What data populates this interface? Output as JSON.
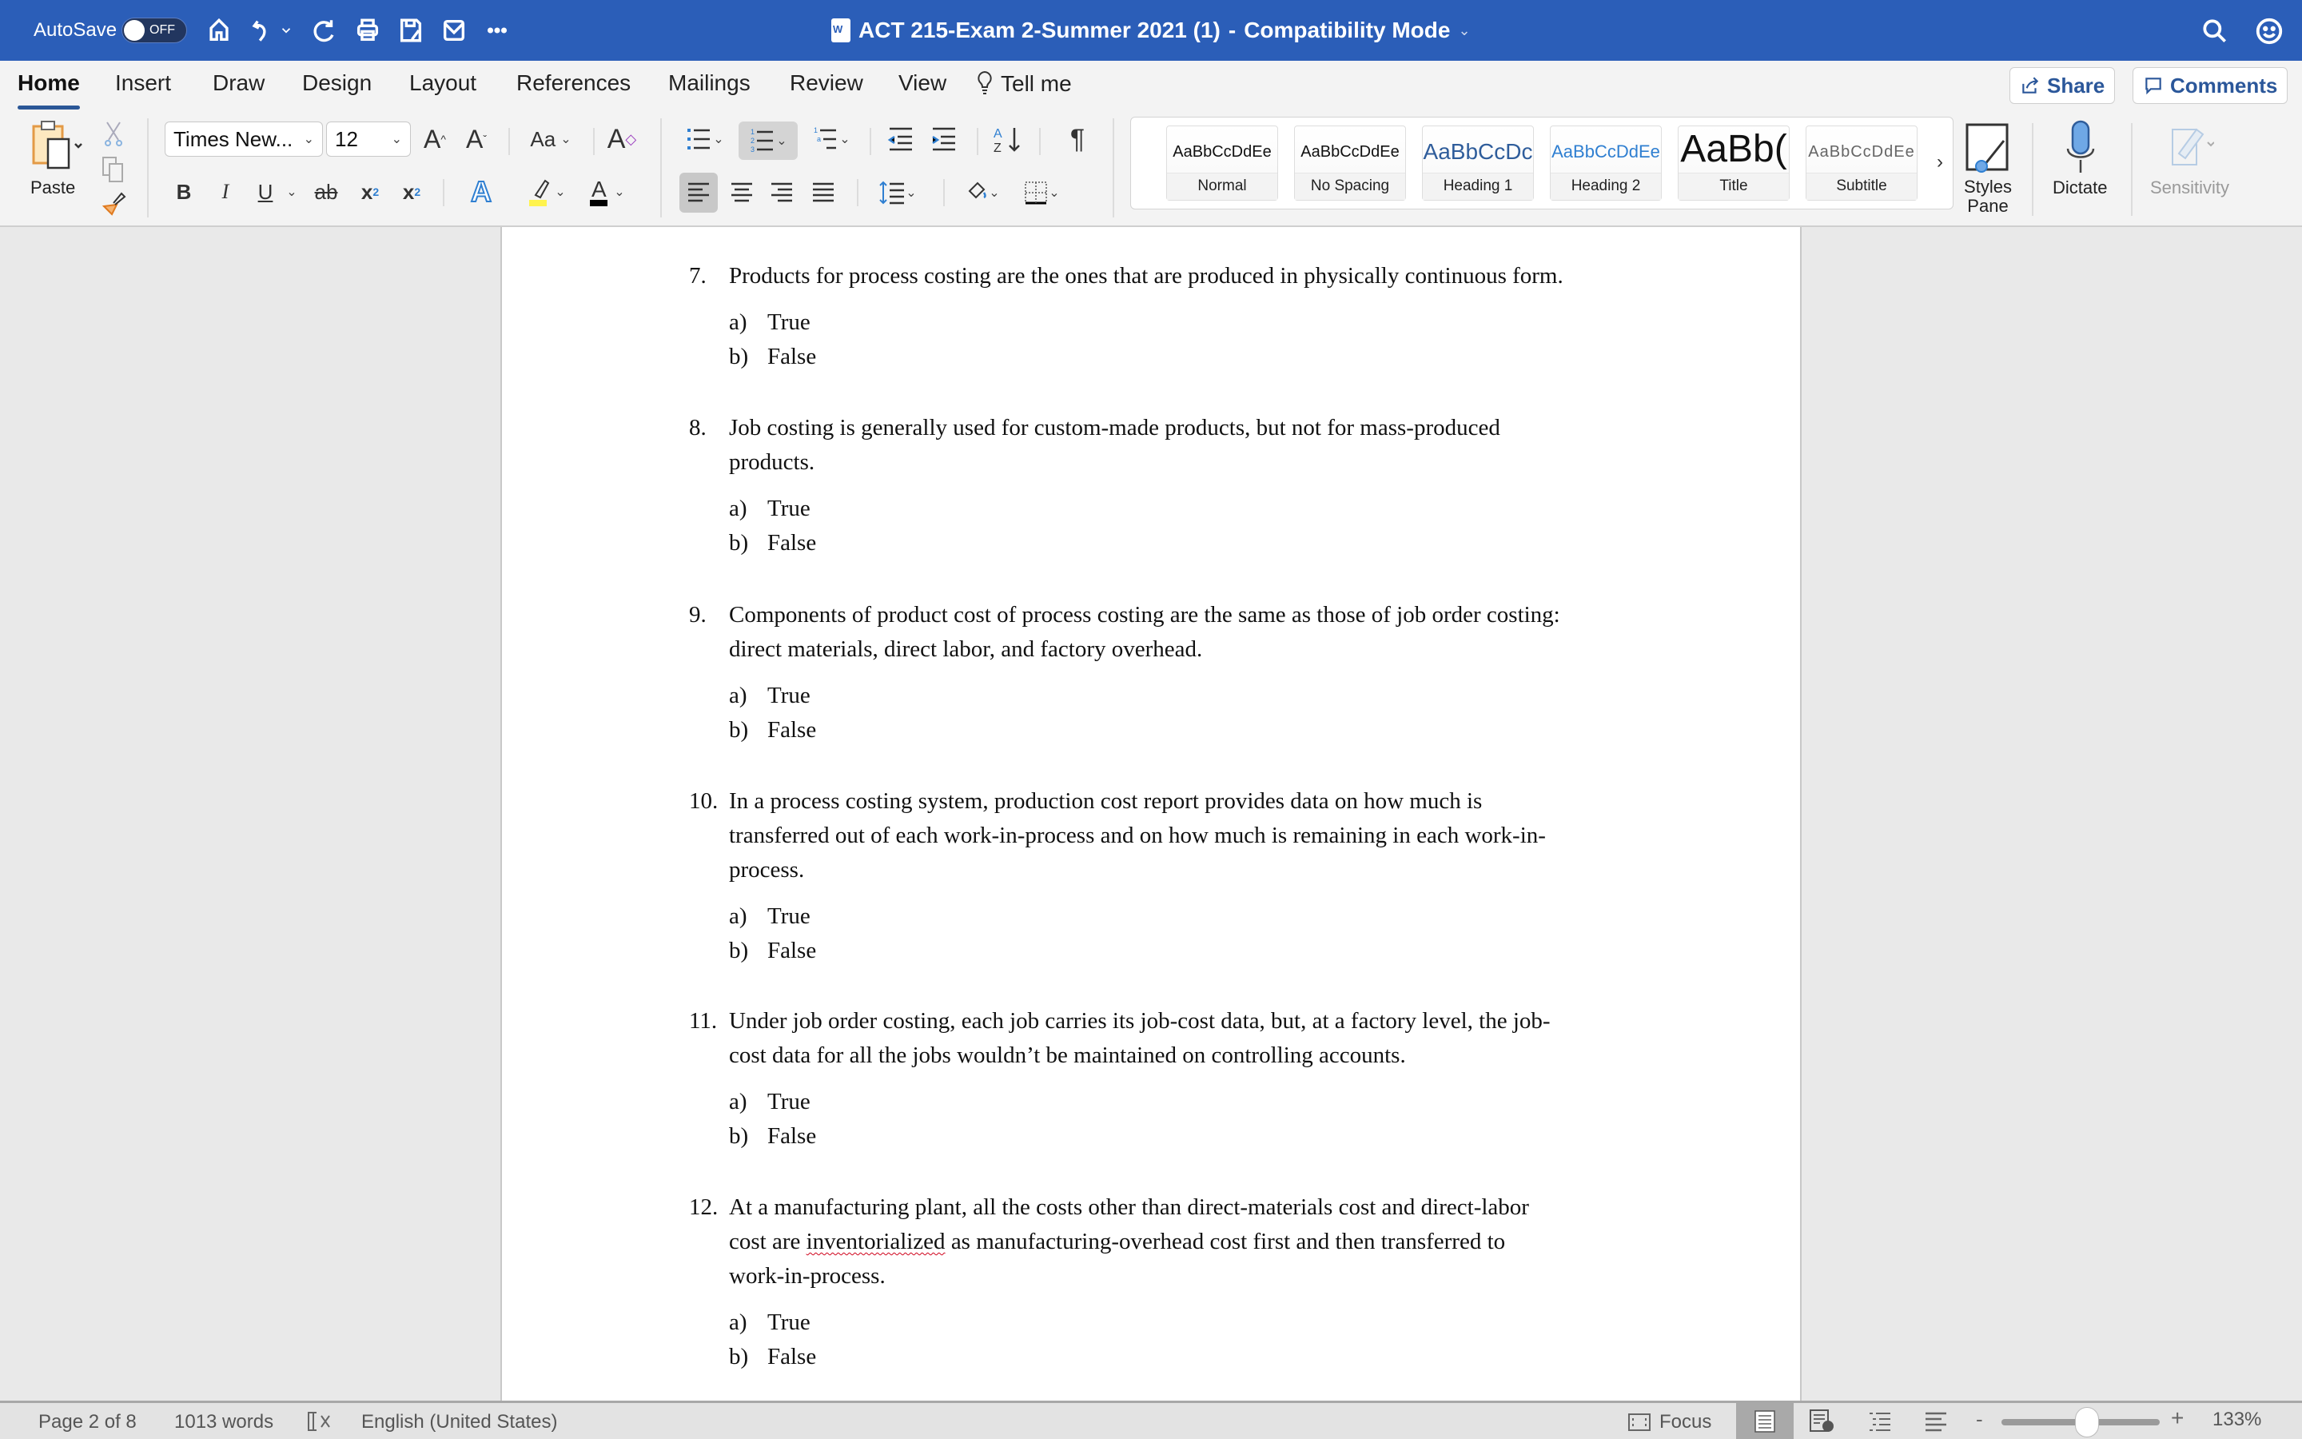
{
  "titlebar": {
    "autosave_label": "AutoSave",
    "autosave_state": "OFF",
    "doc_title": "ACT 215-Exam 2-Summer 2021 (1)",
    "mode": "Compatibility Mode",
    "separator": "-",
    "quick_access": [
      "home-icon",
      "undo-icon",
      "redo-icon",
      "print-icon",
      "save-as-icon",
      "email-icon",
      "more-icon"
    ],
    "accent_color": "#2B5EB8"
  },
  "tabs": [
    {
      "label": "Home",
      "active": true
    },
    {
      "label": "Insert"
    },
    {
      "label": "Draw"
    },
    {
      "label": "Design"
    },
    {
      "label": "Layout"
    },
    {
      "label": "References"
    },
    {
      "label": "Mailings"
    },
    {
      "label": "Review"
    },
    {
      "label": "View"
    },
    {
      "label": "Tell me"
    }
  ],
  "actions": {
    "share": "Share",
    "comments": "Comments"
  },
  "ribbon": {
    "paste_label": "Paste",
    "font_name": "Times New...",
    "font_size": "12",
    "change_case": "Aa",
    "bold": "B",
    "italic": "I",
    "underline": "U",
    "strikethrough": "ab",
    "subscript": "x",
    "superscript": "x",
    "pilcrow": "¶",
    "styles": [
      {
        "preview": "AaBbCcDdEe",
        "name": "Normal"
      },
      {
        "preview": "AaBbCcDdEe",
        "name": "No Spacing"
      },
      {
        "preview": "AaBbCcDc",
        "name": "Heading 1"
      },
      {
        "preview": "AaBbCcDdEe",
        "name": "Heading 2"
      },
      {
        "preview": "AaBb(",
        "name": "Title"
      },
      {
        "preview": "AaBbCcDdEe",
        "name": "Subtitle"
      }
    ],
    "styles_pane": "Styles Pane",
    "dictate": "Dictate",
    "sensitivity": "Sensitivity"
  },
  "document": {
    "questions": [
      {
        "num": "7.",
        "lines": [
          "Products for process costing are the ones that are produced in physically continuous form."
        ],
        "options": [
          [
            "a)",
            "True"
          ],
          [
            "b)",
            "False"
          ]
        ]
      },
      {
        "num": "8.",
        "lines": [
          "Job costing is generally used for custom-made products, but not for mass-produced",
          "products."
        ],
        "options": [
          [
            "a)",
            "True"
          ],
          [
            "b)",
            "False"
          ]
        ]
      },
      {
        "num": "9.",
        "lines": [
          "Components of product cost of process costing are the same as those of job order costing:",
          "direct materials, direct labor, and factory overhead."
        ],
        "options": [
          [
            "a)",
            "True"
          ],
          [
            "b)",
            "False"
          ]
        ]
      },
      {
        "num": "10.",
        "lines": [
          "In a process costing system, production cost report provides data on how much is",
          "transferred out of each work-in-process and on how much is remaining in each work-in-",
          "process."
        ],
        "options": [
          [
            "a)",
            "True"
          ],
          [
            "b)",
            "False"
          ]
        ]
      },
      {
        "num": "11.",
        "lines": [
          "Under job order costing, each job carries its job-cost data, but, at a factory level, the job-",
          "cost data for all the jobs wouldn’t be maintained on controlling accounts."
        ],
        "options": [
          [
            "a)",
            "True"
          ],
          [
            "b)",
            "False"
          ]
        ]
      },
      {
        "num": "12.",
        "lines": [
          "At a manufacturing plant, all the costs other than direct-materials cost and direct-labor",
          "cost are inventorialized as manufacturing-overhead cost first and then transferred to",
          "work-in-process."
        ],
        "options": [
          [
            "a)",
            "True"
          ],
          [
            "b)",
            "False"
          ]
        ],
        "misspelled": "inventorialized"
      }
    ]
  },
  "status": {
    "page": "Page 2 of 8",
    "words": "1013 words",
    "language": "English (United States)",
    "focus": "Focus",
    "zoom_minus": "-",
    "zoom_plus": "+",
    "zoom": "133%",
    "zoom_value": 133
  }
}
